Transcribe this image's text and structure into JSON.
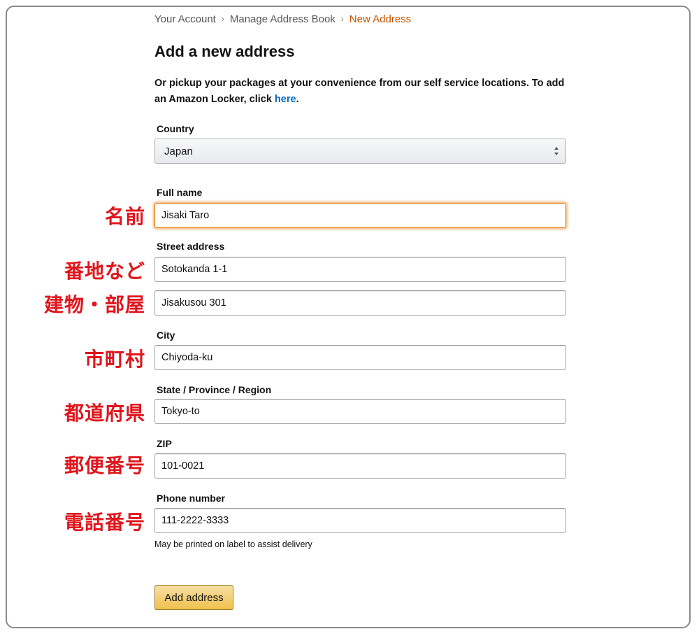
{
  "breadcrumb": {
    "items": [
      "Your Account",
      "Manage Address Book"
    ],
    "current": "New Address",
    "separator": "›"
  },
  "title": "Add a new address",
  "intro": {
    "text": "Or pickup your packages at your convenience from our self service locations. To add an Amazon Locker, click ",
    "link": "here",
    "suffix": "."
  },
  "country": {
    "label": "Country",
    "selected": "Japan"
  },
  "fullname": {
    "label": "Full name",
    "value": "Jisaki Taro"
  },
  "street": {
    "label": "Street address",
    "line1": "Sotokanda 1-1",
    "line2": "Jisakusou 301"
  },
  "city": {
    "label": "City",
    "value": "Chiyoda-ku"
  },
  "state": {
    "label": "State / Province / Region",
    "value": "Tokyo-to"
  },
  "zip": {
    "label": "ZIP",
    "value": "101-0021"
  },
  "phone": {
    "label": "Phone number",
    "value": "111-2222-3333",
    "help": "May be printed on label to assist delivery"
  },
  "submit": {
    "label": "Add address"
  },
  "annotations": {
    "name": "名前",
    "street1": "番地など",
    "street2": "建物・部屋",
    "city": "市町村",
    "state": "都道府県",
    "zip": "郵便番号",
    "phone": "電話番号"
  },
  "colors": {
    "annotation": "#e0151c",
    "link": "#0066c0",
    "breadcrumb_current": "#c45500",
    "button": "#f0c14b",
    "focus": "#e77600"
  }
}
